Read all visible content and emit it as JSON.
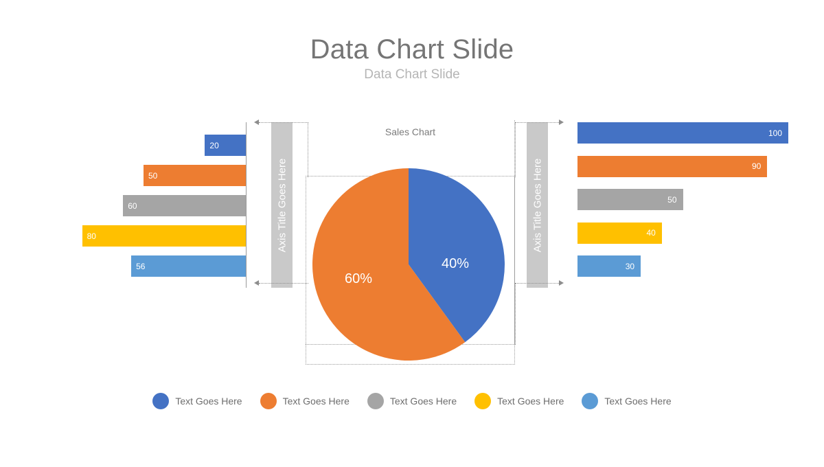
{
  "header": {
    "title": "Data Chart Slide",
    "subtitle": "Data Chart Slide"
  },
  "axis_titles": {
    "left": "Axis Title Goes Here",
    "right": "Axis Title Goes Here"
  },
  "colors": {
    "series_1": "#4472C4",
    "series_2": "#ED7D31",
    "series_3": "#A5A5A5",
    "series_4": "#FFC000",
    "series_5": "#5B9BD5",
    "title": "#757575",
    "subtitle": "#b5b5b5",
    "axis_bar": "#c9c9c9",
    "guide": "#9a9a9a",
    "legend_text": "#6d6d6d",
    "background": "#FFFFFF"
  },
  "legend": {
    "items": [
      {
        "label": "Text Goes Here",
        "color": "#4472C4"
      },
      {
        "label": "Text Goes Here",
        "color": "#ED7D31"
      },
      {
        "label": "Text Goes Here",
        "color": "#A5A5A5"
      },
      {
        "label": "Text Goes Here",
        "color": "#FFC000"
      },
      {
        "label": "Text Goes Here",
        "color": "#5B9BD5"
      }
    ]
  },
  "chart_data": [
    {
      "type": "bar",
      "id": "left-bar-chart",
      "orientation": "horizontal",
      "direction": "right-to-left",
      "title": "",
      "axis_title": "Axis Title Goes Here",
      "categories": [
        "",
        "",
        "",
        "",
        ""
      ],
      "values": [
        20,
        50,
        60,
        80,
        56
      ],
      "labels": [
        "20",
        "50",
        "60",
        "80",
        "56"
      ],
      "colors": [
        "#4472C4",
        "#ED7D31",
        "#A5A5A5",
        "#FFC000",
        "#5B9BD5"
      ],
      "xlabel": "",
      "ylabel": "",
      "xlim": [
        0,
        100
      ],
      "grid": false,
      "legend_position": "bottom"
    },
    {
      "type": "pie",
      "id": "sales-pie-chart",
      "title": "Sales Chart",
      "labels": [
        "40%",
        "60%"
      ],
      "values": [
        40,
        60
      ],
      "colors": [
        "#4472C4",
        "#ED7D31"
      ],
      "start_angle": 0,
      "direction": "clockwise",
      "legend_position": "bottom"
    },
    {
      "type": "bar",
      "id": "right-bar-chart",
      "orientation": "horizontal",
      "direction": "left-to-right",
      "title": "",
      "axis_title": "Axis Title Goes Here",
      "categories": [
        "",
        "",
        "",
        "",
        ""
      ],
      "values": [
        100,
        90,
        50,
        40,
        30
      ],
      "labels": [
        "100",
        "90",
        "50",
        "40",
        "30"
      ],
      "colors": [
        "#4472C4",
        "#ED7D31",
        "#A5A5A5",
        "#FFC000",
        "#5B9BD5"
      ],
      "xlabel": "",
      "ylabel": "",
      "xlim": [
        0,
        100
      ],
      "grid": false,
      "legend_position": "bottom"
    }
  ]
}
